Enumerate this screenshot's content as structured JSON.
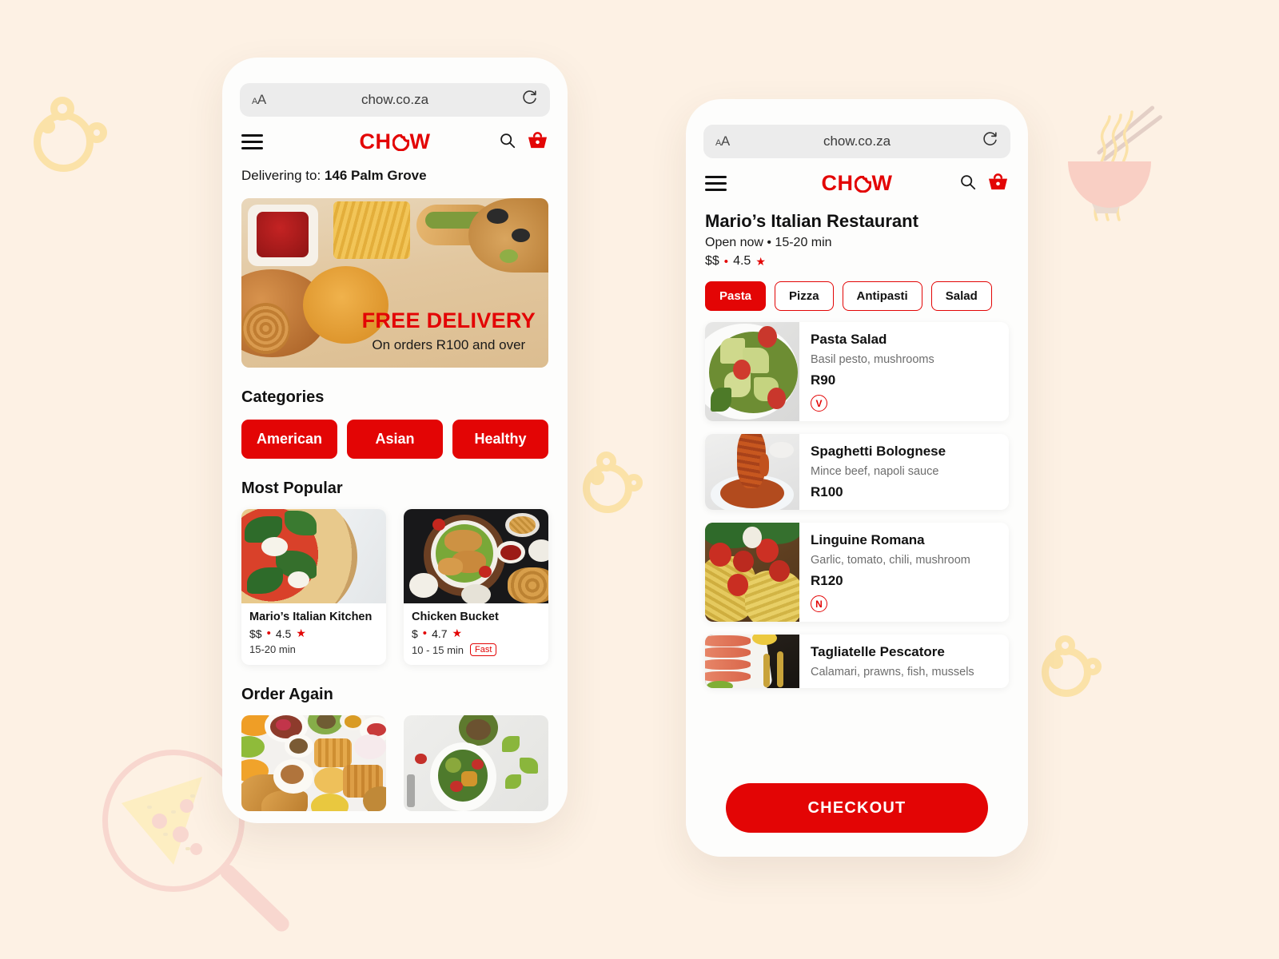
{
  "browser": {
    "text_size_icon": "text-size-icon",
    "url": "chow.co.za",
    "reload_icon": "reload-icon"
  },
  "brand": {
    "name": "CHOW",
    "accent_color": "#e30505",
    "page_background": "#fdf1e4"
  },
  "header": {
    "menu_icon": "hamburger-menu-icon",
    "search_icon": "search-icon",
    "basket_icon": "shopping-basket-icon"
  },
  "home": {
    "delivering_label": "Delivering to:",
    "delivering_address": "146 Palm Grove",
    "hero": {
      "title": "FREE DELIVERY",
      "subtitle": "On orders R100 and over"
    },
    "categories_title": "Categories",
    "categories": [
      "American",
      "Asian",
      "Healthy"
    ],
    "most_popular_title": "Most Popular",
    "most_popular": [
      {
        "name": "Mario’s Italian Kitchen",
        "price_level": "$$",
        "rating": "4.5",
        "time": "15-20 min",
        "tag": ""
      },
      {
        "name": "Chicken Bucket",
        "price_level": "$",
        "rating": "4.7",
        "time": "10 - 15 min",
        "tag": "Fast"
      }
    ],
    "order_again_title": "Order Again"
  },
  "restaurant": {
    "name": "Mario’s Italian Restaurant",
    "status": "Open now • 15-20 min",
    "price_level": "$$",
    "separator": "•",
    "rating": "4.5",
    "filters": [
      {
        "label": "Pasta",
        "active": true
      },
      {
        "label": "Pizza",
        "active": false
      },
      {
        "label": "Antipasti",
        "active": false
      },
      {
        "label": "Salad",
        "active": false
      }
    ],
    "menu": [
      {
        "name": "Pasta Salad",
        "desc": "Basil pesto, mushrooms",
        "price": "R90",
        "badge": "V"
      },
      {
        "name": "Spaghetti Bolognese",
        "desc": "Mince beef, napoli sauce",
        "price": "R100",
        "badge": ""
      },
      {
        "name": "Linguine Romana",
        "desc": "Garlic, tomato, chili, mushroom",
        "price": "R120",
        "badge": "N"
      },
      {
        "name": "Tagliatelle Pescatore",
        "desc": "Calamari, prawns, fish, mussels",
        "price": "",
        "badge": ""
      }
    ],
    "checkout_label": "CHECKOUT"
  },
  "decor": {
    "bowl": "noodle-bowl-illustration",
    "magnifier": "magnifier-pizza-illustration",
    "cookies": "bitten-cookie-illustration"
  }
}
